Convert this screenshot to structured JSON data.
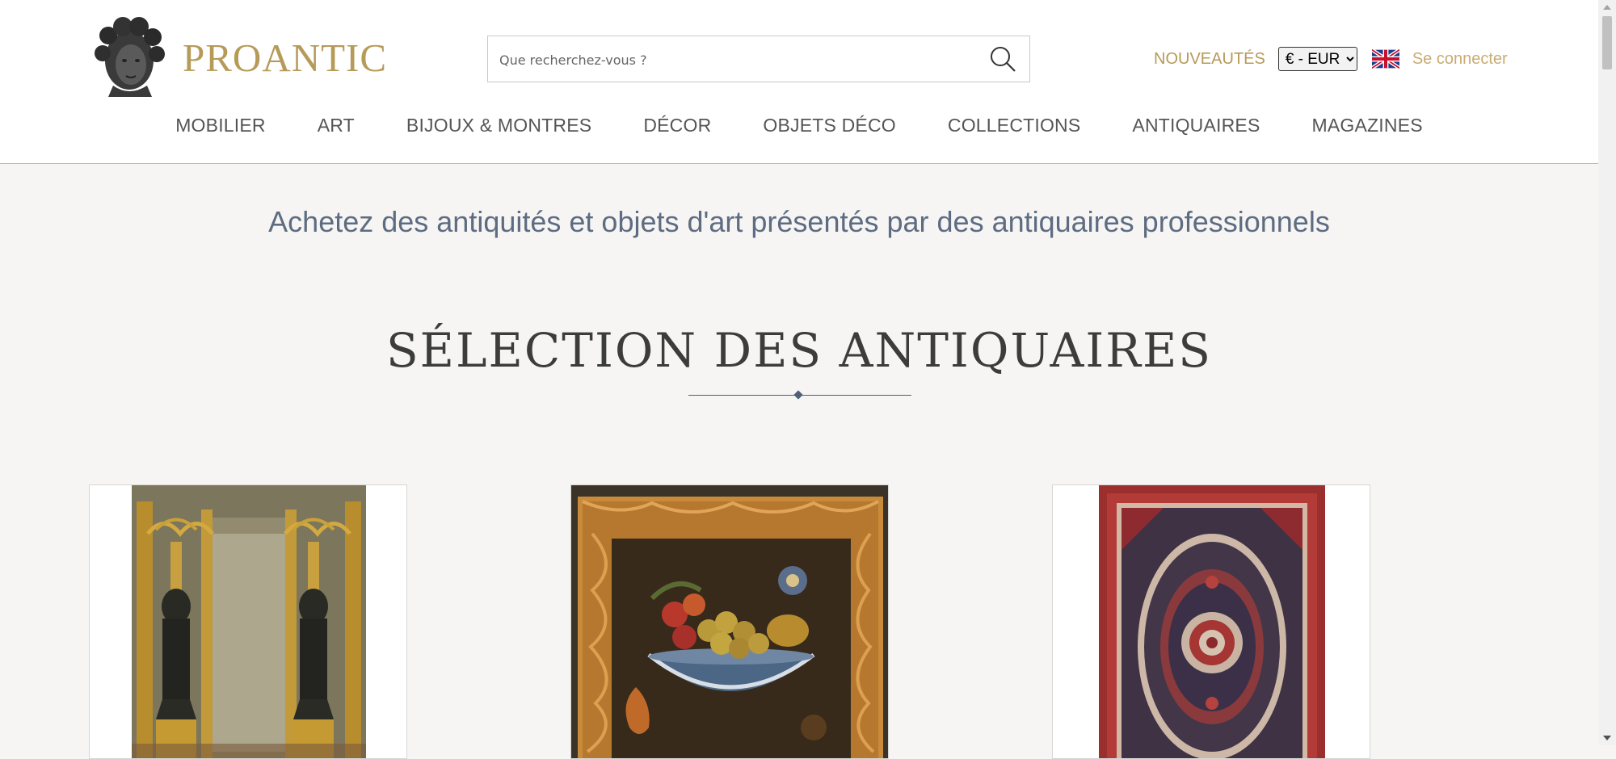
{
  "header": {
    "logo_text": "PROANTIC",
    "search_placeholder": "Que recherchez-vous ?",
    "nouveautes_label": "NOUVEAUTÉS",
    "currency": {
      "selected": "€ - EUR",
      "options": [
        "€ - EUR"
      ]
    },
    "language_flag": "uk-flag-icon",
    "login_label": "Se connecter",
    "icons": {
      "search": "search-icon",
      "logo": "logo-bust-icon"
    }
  },
  "nav": {
    "items": [
      {
        "label": "MOBILIER"
      },
      {
        "label": "ART"
      },
      {
        "label": "BIJOUX & MONTRES"
      },
      {
        "label": "DÉCOR"
      },
      {
        "label": "OBJETS DÉCO"
      },
      {
        "label": "COLLECTIONS"
      },
      {
        "label": "ANTIQUAIRES"
      },
      {
        "label": "MAGAZINES"
      }
    ]
  },
  "main": {
    "tagline": "Achetez des antiquités et objets d'art présentés par des antiquaires professionnels",
    "section_title": "SÉLECTION DES ANTIQUAIRES"
  },
  "cards": [
    {
      "image": "bronze-candelabra-pair"
    },
    {
      "image": "still-life-fruit-painting"
    },
    {
      "image": "persian-silk-rug"
    }
  ],
  "colors": {
    "gold": "#b69a58",
    "navy": "#4f5f7a",
    "background": "#f6f5f3"
  }
}
